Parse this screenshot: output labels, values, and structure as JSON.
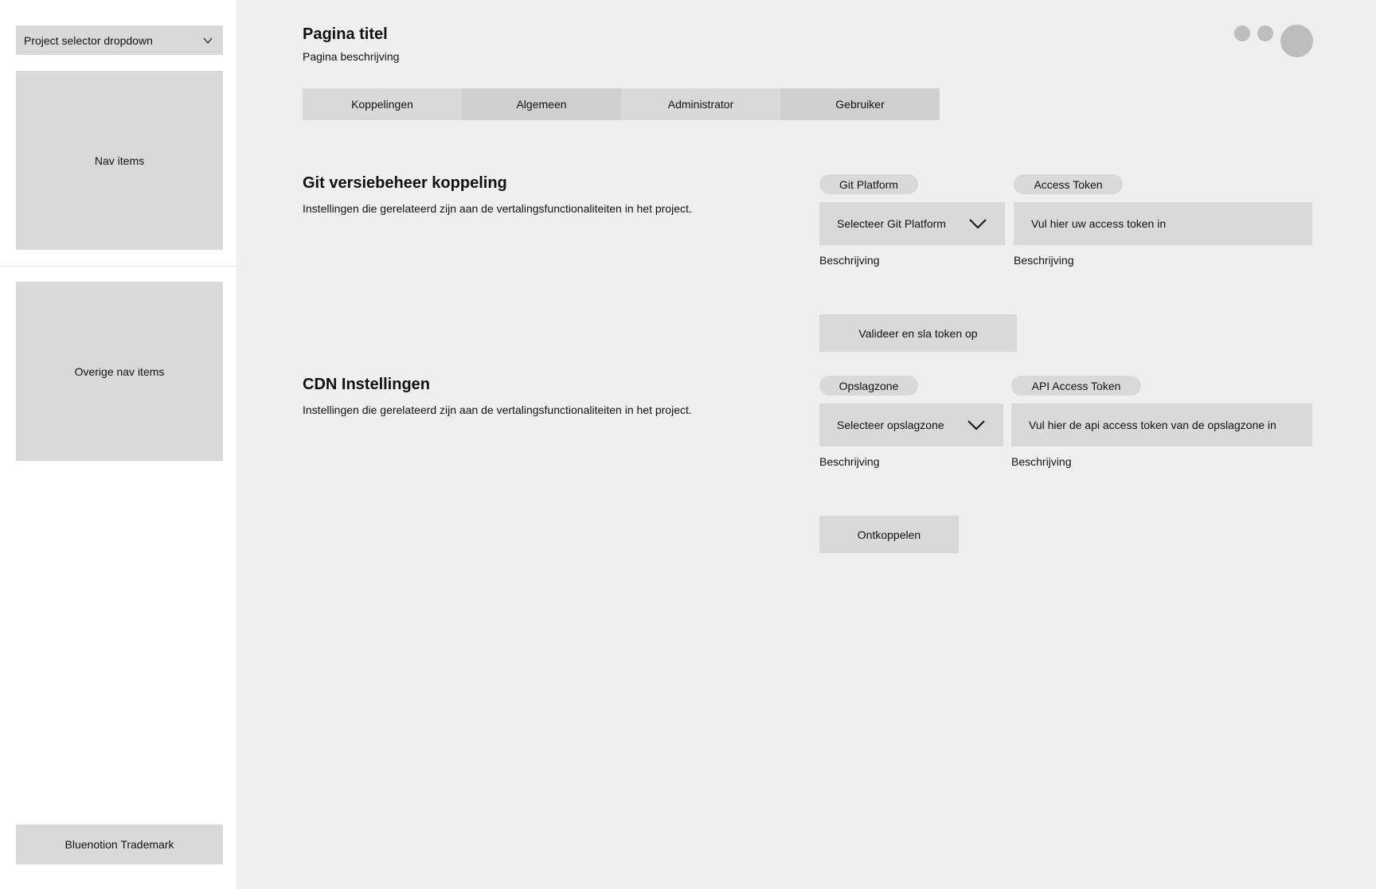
{
  "sidebar": {
    "project_selector": "Project selector dropdown",
    "nav_items": "Nav items",
    "other_nav_items": "Overige nav items",
    "trademark": "Bluenotion Trademark"
  },
  "header": {
    "title": "Pagina titel",
    "description": "Pagina beschrijving"
  },
  "tabs": [
    {
      "label": "Koppelingen"
    },
    {
      "label": "Algemeen"
    },
    {
      "label": "Administrator"
    },
    {
      "label": "Gebruiker"
    }
  ],
  "git_section": {
    "title": "Git versiebeheer koppeling",
    "description": "Instellingen die gerelateerd zijn aan de vertalingsfunctionaliteiten in het project.",
    "platform_label": "Git Platform",
    "platform_placeholder": "Selecteer Git Platform",
    "platform_helper": "Beschrijving",
    "token_label": "Access Token",
    "token_placeholder": "Vul hier uw access token in",
    "token_helper": "Beschrijving",
    "button": "Valideer en sla token op"
  },
  "cdn_section": {
    "title": "CDN Instellingen",
    "description": "Instellingen die gerelateerd zijn aan de vertalingsfunctionaliteiten in het project.",
    "zone_label": "Opslagzone",
    "zone_placeholder": "Selecteer opslagzone",
    "zone_helper": "Beschrijving",
    "token_label": "API Access Token",
    "token_placeholder": "Vul hier de api access token van de opslagzone in",
    "token_helper": "Beschrijving",
    "button": "Ontkoppelen"
  },
  "icons": {
    "project_selector": "chevron-down-icon",
    "select": "chevron-down-icon"
  }
}
